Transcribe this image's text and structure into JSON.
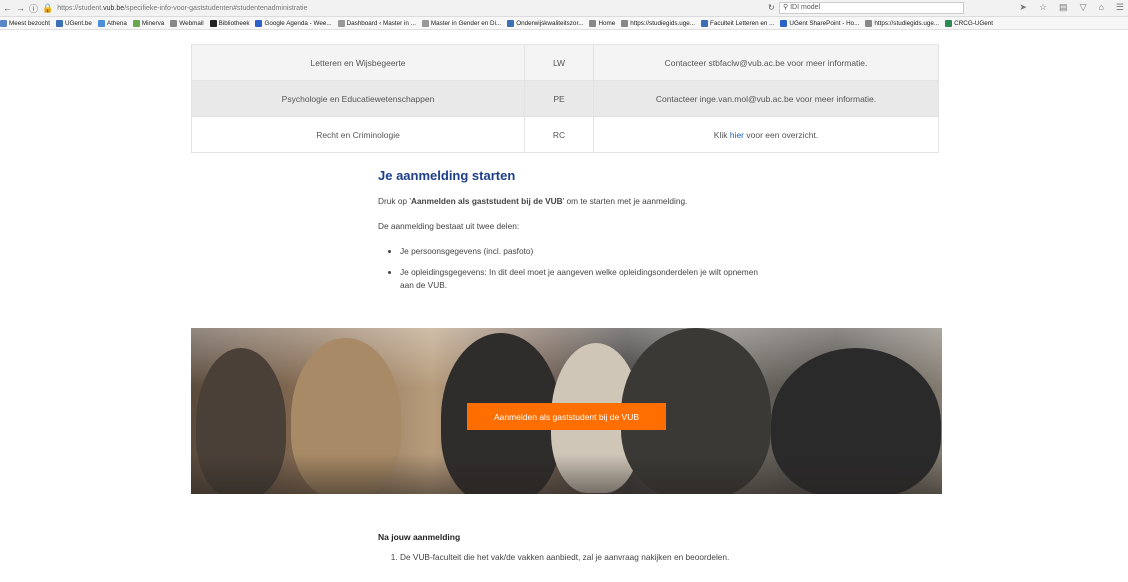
{
  "browser": {
    "url_prefix": "https://student.",
    "url_domain": "vub.be",
    "url_path": "/specifieke-info-voor-gaststudenten#studentenadministratie",
    "search_value": "IDI model"
  },
  "bookmarks": [
    {
      "label": "Meest bezocht",
      "color": "#5a86c5"
    },
    {
      "label": "UGent.be",
      "color": "#3b6fb6"
    },
    {
      "label": "Athena",
      "color": "#4a90d9"
    },
    {
      "label": "Minerva",
      "color": "#6aa84f"
    },
    {
      "label": "Webmail",
      "color": "#888888"
    },
    {
      "label": "Bibliotheek",
      "color": "#222222"
    },
    {
      "label": "Google Agenda - Wee...",
      "color": "#2b62c7"
    },
    {
      "label": "Dashboard ‹ Master in ...",
      "color": "#999999"
    },
    {
      "label": "Master in Gender en Di...",
      "color": "#999999"
    },
    {
      "label": "Onderwijskwaliteitszor...",
      "color": "#3b6fb6"
    },
    {
      "label": "Home",
      "color": "#888888"
    },
    {
      "label": "https://studiegids.uge...",
      "color": "#888888"
    },
    {
      "label": "Faculteit Letteren en ...",
      "color": "#3b6fb6"
    },
    {
      "label": "UGent SharePoint - Ho...",
      "color": "#2b62c7"
    },
    {
      "label": "https://studiegids.uge...",
      "color": "#888888"
    },
    {
      "label": "CRCG-UGent",
      "color": "#2e8b57"
    }
  ],
  "table": {
    "rows": [
      {
        "faculty": "Letteren en Wijsbegeerte",
        "code": "LW",
        "info": "Contacteer stbfaclw@vub.ac.be voor meer informatie."
      },
      {
        "faculty": "Psychologie en Educatiewetenschappen",
        "code": "PE",
        "info": "Contacteer inge.van.mol@vub.ac.be voor meer informatie."
      }
    ],
    "last_row": {
      "faculty": "Recht en Criminologie",
      "code": "RC",
      "info_pre": "Klik ",
      "info_link": "hier",
      "info_post": " voor een overzicht."
    }
  },
  "start": {
    "heading": "Je aanmelding starten",
    "p1_pre": "Druk op '",
    "p1_bold": "Aanmelden als gaststudent bij de VUB",
    "p1_post": "' om te starten met je aanmelding.",
    "p2": "De aanmelding bestaat uit twee delen:",
    "items": [
      "Je persoonsgegevens (incl. pasfoto)",
      "Je opleidingsgegevens: In dit deel moet je aangeven welke opleidingsonderdelen je wilt opnemen aan de VUB."
    ]
  },
  "banner": {
    "button_label": "Aanmelden als gaststudent bij de VUB"
  },
  "after": {
    "heading": "Na jouw aanmelding",
    "items": [
      "De VUB-faculteit die het vak/de vakken aanbiedt, zal je aanvraag nakijken en beoordelen."
    ]
  },
  "colors": {
    "accent_orange": "#ff6e00",
    "heading_blue": "#1d3f8a",
    "link_blue": "#1a63b3"
  }
}
